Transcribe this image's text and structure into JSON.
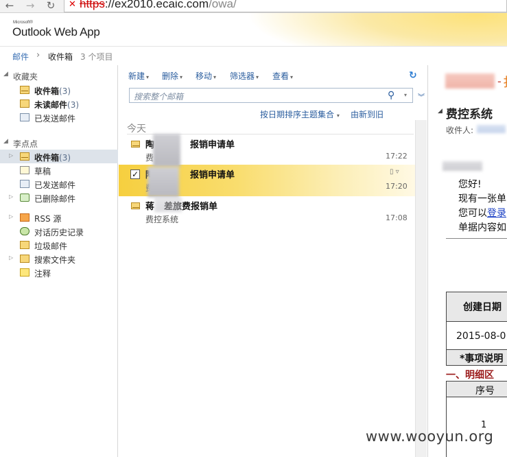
{
  "browser": {
    "url_scheme": "https",
    "url_host": "://ex2010.ecaic.com",
    "url_path": "/owa/",
    "back_icon": "back-arrow-icon",
    "forward_icon": "forward-arrow-icon",
    "reload_icon": "reload-icon"
  },
  "header": {
    "brand_small": "Microsoft®",
    "app_name": "Outlook Web App"
  },
  "breadcrumb": {
    "root": "邮件",
    "sep": "›",
    "current": "收件箱",
    "count": "3 个项目"
  },
  "folders": {
    "favorites": {
      "title": "收藏夹",
      "items": [
        {
          "label": "收件箱",
          "count": "(3)",
          "icon": "inbox-icon"
        },
        {
          "label": "未读邮件",
          "count": "(3)",
          "icon": "search-folder-icon"
        },
        {
          "label": "已发送邮件",
          "count": "",
          "icon": "sent-icon"
        }
      ]
    },
    "mailbox": {
      "title": "李点点",
      "items": [
        {
          "label": "收件箱",
          "count": "(3)",
          "icon": "inbox-icon",
          "selected": true
        },
        {
          "label": "草稿",
          "count": "",
          "icon": "drafts-icon"
        },
        {
          "label": "已发送邮件",
          "count": "",
          "icon": "sent-icon"
        },
        {
          "label": "已删除邮件",
          "count": "",
          "icon": "deleted-icon"
        },
        {
          "label": "RSS 源",
          "count": "",
          "icon": "rss-icon"
        },
        {
          "label": "对话历史记录",
          "count": "",
          "icon": "conversation-history-icon"
        },
        {
          "label": "垃圾邮件",
          "count": "",
          "icon": "junk-icon"
        },
        {
          "label": "搜索文件夹",
          "count": "",
          "icon": "search-folder-icon"
        },
        {
          "label": "注释",
          "count": "",
          "icon": "notes-icon"
        }
      ]
    }
  },
  "toolbar": {
    "new": "新建",
    "delete": "删除",
    "move": "移动",
    "filter": "筛选器",
    "view": "查看"
  },
  "search": {
    "placeholder": "搜索整个邮箱"
  },
  "list": {
    "sort_label": "按日期排序主题集合",
    "order_label": "由新到旧",
    "group_header": "今天",
    "messages": [
      {
        "subject_prefix": "陶",
        "subject": "报销申请单",
        "sender": "费",
        "time": "17:22",
        "selected": false
      },
      {
        "subject_prefix": "陶",
        "subject": "报销申请单",
        "sender": "费",
        "time": "17:20",
        "selected": true
      },
      {
        "subject_prefix": "蒋",
        "subject": "差旅费报销单",
        "sender": "费控系统",
        "time": "17:08",
        "selected": false
      }
    ]
  },
  "reading": {
    "subject": "费控系统",
    "to_label": "收件人:",
    "greeting": "您好!",
    "line1": "现有一张单",
    "line2_prefix": "您可以",
    "line2_link": "登录",
    "line3": "单据内容如",
    "table_header": "创建日期",
    "table_date": "2015-08-0",
    "table_note": "*事项说明",
    "section_title": "一、明细区",
    "col_seq": "序号",
    "row_seq": "1"
  },
  "watermark": "www.wooyun.org"
}
